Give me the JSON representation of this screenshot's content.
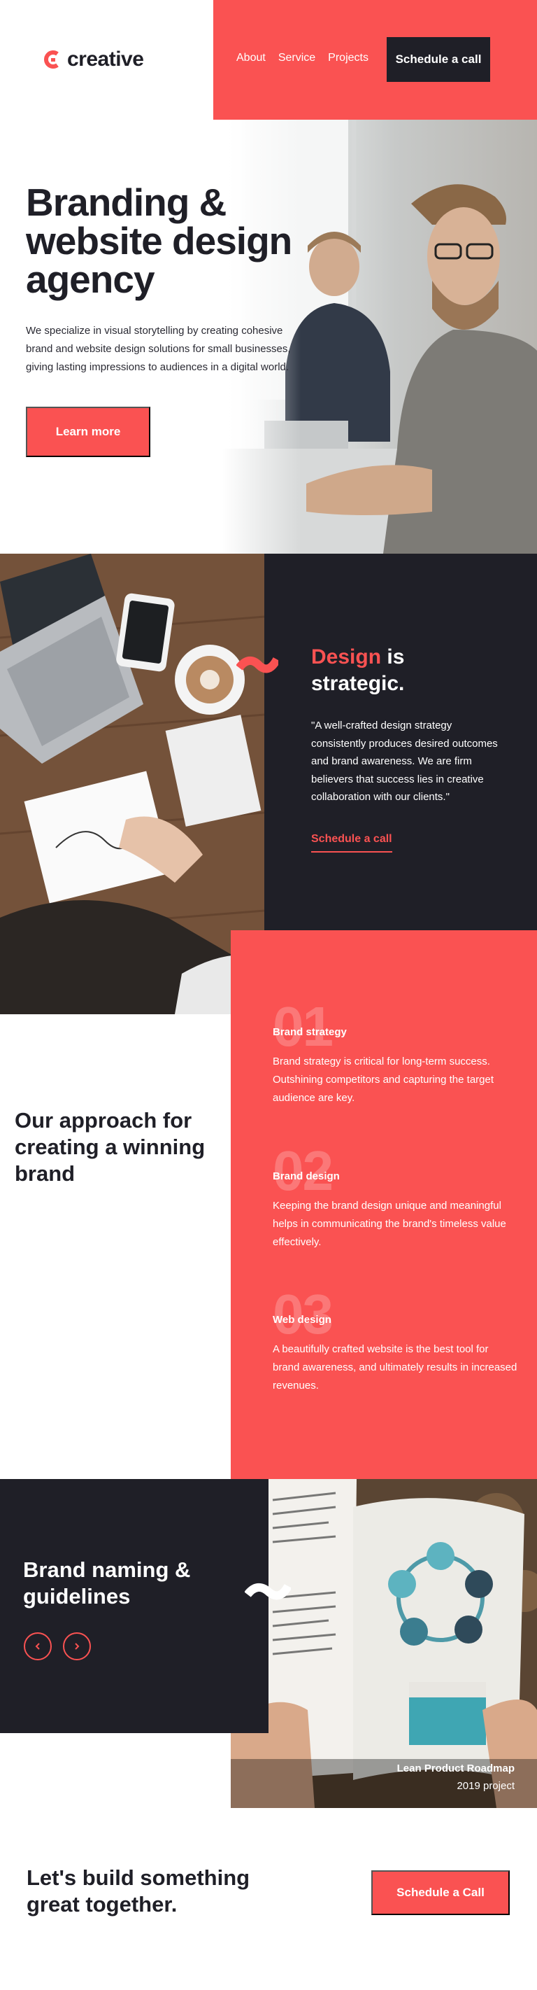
{
  "header": {
    "logo_text": "creative",
    "nav": [
      "About",
      "Service",
      "Projects"
    ],
    "cta_label": "Schedule a call"
  },
  "hero": {
    "title": "Branding & website design agency",
    "description": "We specialize in visual storytelling by creating cohesive brand and website design solutions for small businesses, giving lasting impressions to audiences in a digital world.",
    "button_label": "Learn more"
  },
  "strategy": {
    "title_accent": "Design",
    "title_rest": " is strategic.",
    "quote": "\"A well-crafted design strategy consistently produces desired outcomes and brand awareness. We are firm believers that success lies in creative collaboration with our clients.\"",
    "link_label": "Schedule a call"
  },
  "approach": {
    "title": "Our approach for creating a winning brand",
    "steps": [
      {
        "num": "01",
        "title": "Brand strategy",
        "text": "Brand strategy is critical for long-term success. Outshining competitors and capturing the target audience are key."
      },
      {
        "num": "02",
        "title": "Brand design",
        "text": "Keeping the brand design unique and meaningful helps in communicating the brand's timeless value effectively."
      },
      {
        "num": "03",
        "title": "Web design",
        "text": "A beautifully crafted website is the best tool for brand awareness, and ultimately results in increased revenues."
      }
    ]
  },
  "slider": {
    "title": "Brand naming & guidelines",
    "prev_icon": "chevron-left-icon",
    "next_icon": "chevron-right-icon",
    "project_title": "Lean Product Roadmap",
    "project_year": "2019 project"
  },
  "footer": {
    "title": "Let's build something great together.",
    "button_label": "Schedule a Call"
  },
  "colors": {
    "accent": "#fa5252",
    "dark": "#1f1f27",
    "white": "#ffffff"
  }
}
